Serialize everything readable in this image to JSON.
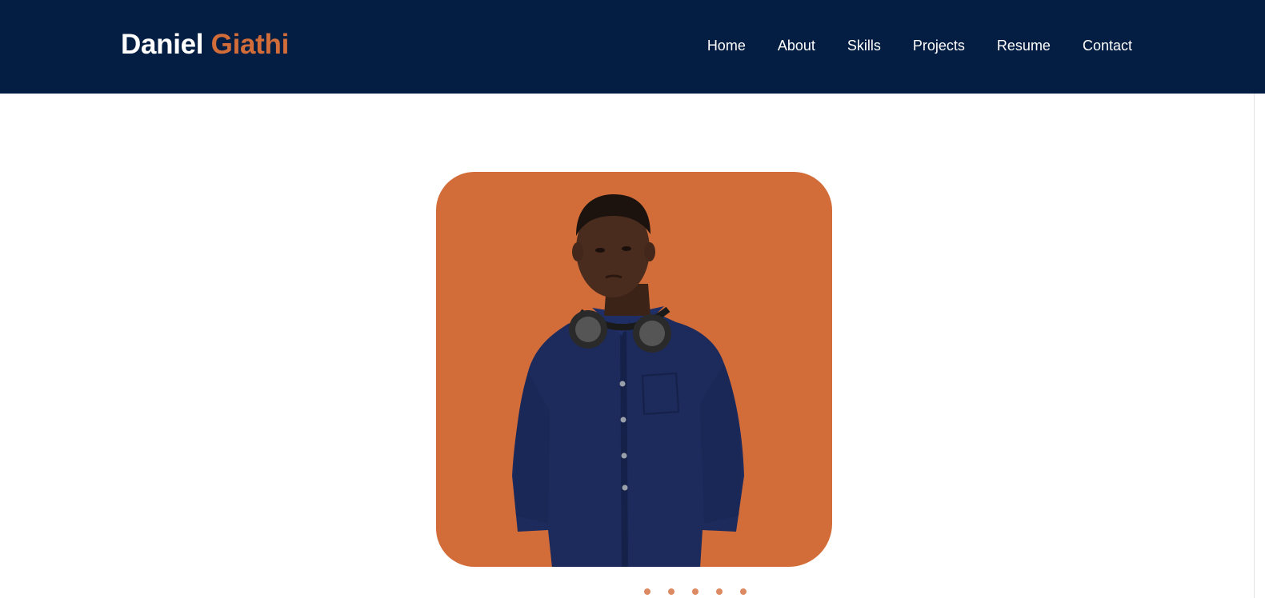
{
  "brand": {
    "first_name": "Daniel",
    "last_name": "Giathi"
  },
  "nav": {
    "items": [
      {
        "label": "Home"
      },
      {
        "label": "About"
      },
      {
        "label": "Skills"
      },
      {
        "label": "Projects"
      },
      {
        "label": "Resume"
      },
      {
        "label": "Contact"
      }
    ]
  },
  "colors": {
    "header_bg": "#041d43",
    "accent": "#d26d3a",
    "text_light": "#ffffff"
  },
  "hero": {
    "image": "profile-photo"
  }
}
